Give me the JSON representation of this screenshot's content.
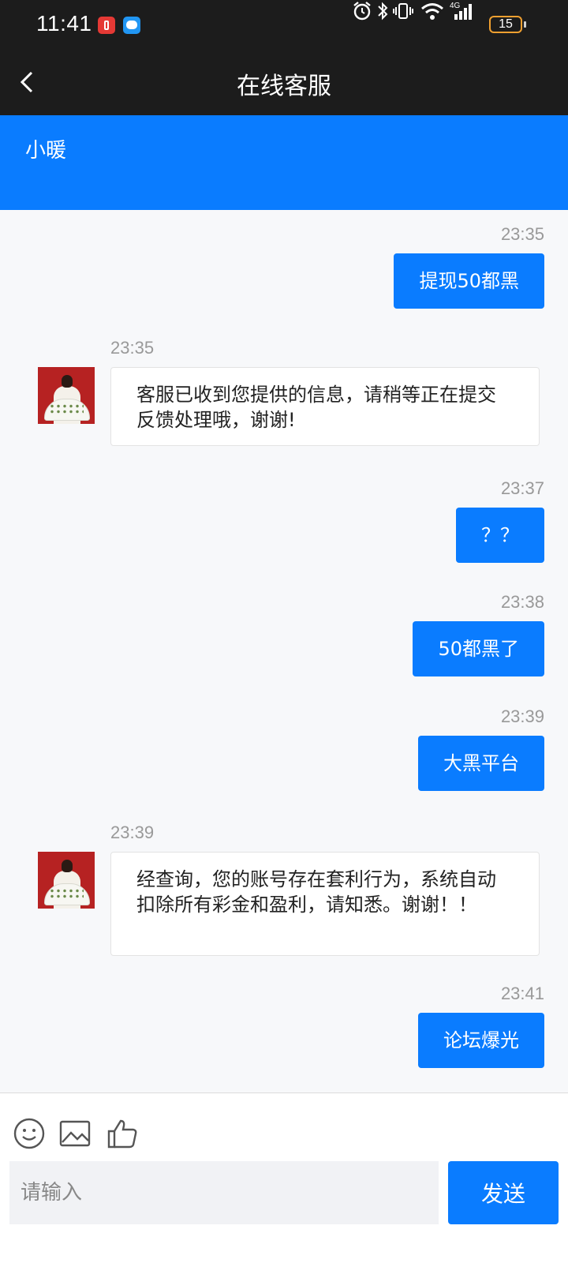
{
  "status_bar": {
    "time": "11:41",
    "battery": "15",
    "icons": [
      "alarm-icon",
      "bluetooth-icon",
      "vibrate-icon",
      "wifi-icon",
      "4g-signal-icon",
      "battery-icon"
    ]
  },
  "header": {
    "title": "在线客服",
    "back_icon": "chevron-left-icon"
  },
  "agent": {
    "name": "小暖"
  },
  "messages": [
    {
      "side": "out",
      "time": "23:35",
      "text": "提现50都黑"
    },
    {
      "side": "in",
      "time": "23:35",
      "text": "客服已收到您提供的信息，请稍等正在提交反馈处理哦，谢谢!"
    },
    {
      "side": "out",
      "time": "23:37",
      "text": "？？"
    },
    {
      "side": "out",
      "time": "23:38",
      "text": "50都黑了"
    },
    {
      "side": "out",
      "time": "23:39",
      "text": "大黑平台"
    },
    {
      "side": "in",
      "time": "23:39",
      "text": "经查询，您的账号存在套利行为，系统自动扣除所有彩金和盈利，请知悉。谢谢！！"
    },
    {
      "side": "out",
      "time": "23:41",
      "text": "论坛爆光"
    }
  ],
  "composer": {
    "tools": [
      "emoji-icon",
      "image-icon",
      "thumbs-up-icon"
    ],
    "placeholder": "请输入",
    "value": "",
    "send_label": "发送"
  },
  "colors": {
    "accent": "#0a7cff",
    "header_bg": "#1c1c1c",
    "chat_bg": "#f7f8fa"
  }
}
